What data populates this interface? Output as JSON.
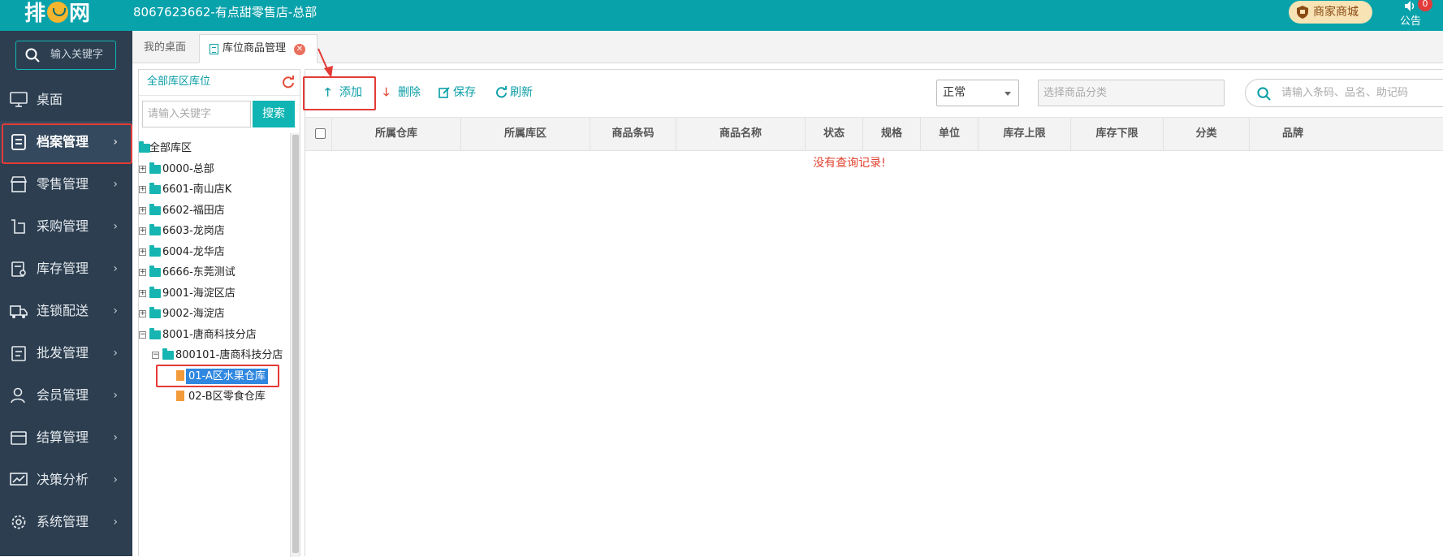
{
  "header": {
    "logo_text": "排队网",
    "store_title": "8067623662-有点甜零售店-总部",
    "mall_button": "商家商城",
    "notice_label": "公告",
    "notice_count": "0"
  },
  "sidebar": {
    "search_placeholder": "输入关键字",
    "items": [
      {
        "label": "桌面",
        "icon": "monitor-icon"
      },
      {
        "label": "档案管理",
        "icon": "archive-icon"
      },
      {
        "label": "零售管理",
        "icon": "store-icon"
      },
      {
        "label": "采购管理",
        "icon": "purchase-icon"
      },
      {
        "label": "库存管理",
        "icon": "inventory-icon"
      },
      {
        "label": "连锁配送",
        "icon": "truck-icon"
      },
      {
        "label": "批发管理",
        "icon": "wholesale-icon"
      },
      {
        "label": "会员管理",
        "icon": "member-icon"
      },
      {
        "label": "结算管理",
        "icon": "settlement-icon"
      },
      {
        "label": "决策分析",
        "icon": "chart-icon"
      },
      {
        "label": "系统管理",
        "icon": "settings-icon"
      }
    ],
    "active_index": 1
  },
  "tabs": [
    {
      "label": "我的桌面"
    },
    {
      "label": "库位商品管理"
    }
  ],
  "tree": {
    "header": "全部库区库位",
    "search_placeholder": "请输入关键字",
    "search_button": "搜索",
    "nodes": [
      {
        "label": "全部库区"
      },
      {
        "label": "0000-总部"
      },
      {
        "label": "6601-南山店K"
      },
      {
        "label": "6602-福田店"
      },
      {
        "label": "6603-龙岗店"
      },
      {
        "label": "6004-龙华店"
      },
      {
        "label": "6666-东莞测试"
      },
      {
        "label": "9001-海淀区店"
      },
      {
        "label": "9002-海淀店"
      },
      {
        "label": "8001-唐商科技分店"
      },
      {
        "label": "800101-唐商科技分店"
      },
      {
        "label": "01-A区水果仓库"
      },
      {
        "label": "02-B区零食仓库"
      }
    ],
    "selected": "01-A区水果仓库"
  },
  "toolbar": {
    "add": "添加",
    "delete": "删除",
    "save": "保存",
    "refresh": "刷新",
    "status_value": "正常",
    "category_placeholder": "选择商品分类",
    "code_placeholder": "请输入条码、品名、助记码"
  },
  "grid": {
    "columns": [
      "所属仓库",
      "所属库区",
      "商品条码",
      "商品名称",
      "状态",
      "规格",
      "单位",
      "库存上限",
      "库存下限",
      "分类",
      "品牌"
    ],
    "empty_message": "没有查询记录!"
  },
  "colors": {
    "topbar": "#08a2ab",
    "sidebar": "#2c3e50",
    "accent": "#10b5b3",
    "highlight": "#e33b36"
  }
}
